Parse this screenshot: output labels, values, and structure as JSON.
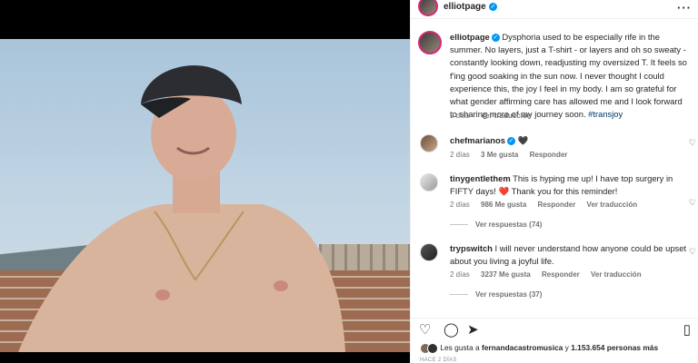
{
  "post": {
    "username": "elliotpage",
    "caption_user": "elliotpage",
    "caption": "Dysphoria used to be especially rife in the summer. No layers, just a T-shirt - or layers and oh so sweaty - constantly looking down, readjusting my oversized T. It feels so f'ing good soaking in the sun now. I never thought I could experience this, the joy I feel in my body. I am so grateful for what gender affirming care has allowed me and I look forward to sharing more of my journey soon.",
    "hashtag": "#transjoy",
    "caption_age": "2 días",
    "see_translation": "Ver traducción",
    "more_icon": "ellipsis-icon"
  },
  "comments": [
    {
      "username": "chefmarianos",
      "verified": true,
      "text": "🖤",
      "age": "2 días",
      "likes": "3 Me gusta",
      "reply": "Responder"
    },
    {
      "username": "tinygentlethem",
      "text": "This is hyping me up! I have top surgery in FIFTY days! ❤️ Thank you for this reminder!",
      "age": "2 días",
      "likes": "986 Me gusta",
      "reply": "Responder",
      "translate": "Ver traducción",
      "view_replies": "Ver respuestas (74)"
    },
    {
      "username": "trypswitch",
      "text": "I will never understand how anyone could be upset about you living a joyful life.",
      "age": "2 días",
      "likes": "3237 Me gusta",
      "reply": "Responder",
      "translate": "Ver traducción",
      "view_replies": "Ver respuestas (37)"
    }
  ],
  "likes": {
    "prefix": "Les gusta a",
    "user": "fernandacastromusica",
    "connector": "y",
    "count": "1.153.654 personas más"
  },
  "date": "HACE 2 DÍAS",
  "icons": {
    "like": "heart-icon",
    "comment": "comment-icon",
    "share": "send-icon",
    "save": "bookmark-icon"
  }
}
